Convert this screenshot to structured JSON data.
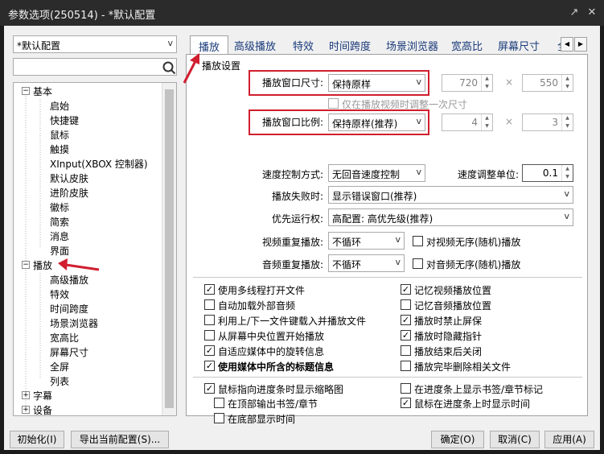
{
  "window": {
    "title": "参数选项(250514) - *默认配置"
  },
  "profile_select": {
    "value": "*默认配置"
  },
  "search": {
    "placeholder": ""
  },
  "tree": {
    "basic": {
      "label": "基本",
      "children": [
        "启始",
        "快捷键",
        "鼠标",
        "触摸",
        "XInput(XBOX 控制器)",
        "默认皮肤",
        "进阶皮肤",
        "徽标",
        "简索",
        "消息",
        "界面"
      ]
    },
    "play": {
      "label": "播放",
      "children": [
        "高级播放",
        "特效",
        "时间跨度",
        "场景浏览器",
        "宽高比",
        "屏幕尺寸",
        "全屏",
        "列表"
      ]
    },
    "subtitle": {
      "label": "字幕"
    },
    "device": {
      "label": "设备"
    }
  },
  "tabs": [
    "播放",
    "高级播放",
    "特效",
    "时间跨度",
    "场景浏览器",
    "宽高比",
    "屏幕尺寸",
    "全"
  ],
  "group_title": "播放设置",
  "settings": {
    "window_size": {
      "label": "播放窗口尺寸:",
      "value": "保持原样",
      "w": "720",
      "h": "550"
    },
    "once_label": "仅在播放视频时调整一次尺寸",
    "window_ratio": {
      "label": "播放窗口比例:",
      "value": "保持原样(推荐)",
      "a": "4",
      "b": "3"
    },
    "speed": {
      "label": "速度控制方式:",
      "value": "无回音速度控制",
      "unit_label": "速度调整单位:",
      "unit": "0.1"
    },
    "fail": {
      "label": "播放失败时:",
      "value": "显示错误窗口(推荐)"
    },
    "priority": {
      "label": "优先运行权:",
      "value": "高配置: 高优先级(推荐)"
    },
    "video_repeat": {
      "label": "视频重复播放:",
      "value": "不循环",
      "shuffle": "对视频无序(随机)播放"
    },
    "audio_repeat": {
      "label": "音频重复播放:",
      "value": "不循环",
      "shuffle": "对音频无序(随机)播放"
    },
    "times": "×"
  },
  "checks_left": [
    {
      "label": "使用多线程打开文件",
      "checked": true,
      "bold": false
    },
    {
      "label": "自动加载外部音频",
      "checked": false,
      "bold": false
    },
    {
      "label": "利用上/下一文件键载入并播放文件",
      "checked": false,
      "bold": false
    },
    {
      "label": "从屏幕中央位置开始播放",
      "checked": false,
      "bold": false
    },
    {
      "label": "自适应媒体中的旋转信息",
      "checked": true,
      "bold": false
    },
    {
      "label": "使用媒体中所含的标题信息",
      "checked": true,
      "bold": true
    }
  ],
  "checks_right": [
    {
      "label": "记忆视频播放位置",
      "checked": true
    },
    {
      "label": "记忆音频播放位置",
      "checked": false
    },
    {
      "label": "播放时禁止屏保",
      "checked": true
    },
    {
      "label": "播放时隐藏指针",
      "checked": true
    },
    {
      "label": "播放结束后关闭",
      "checked": false
    },
    {
      "label": "播放完毕删除相关文件",
      "checked": false
    }
  ],
  "checks_bottom": {
    "thumb": {
      "label": "鼠标指向进度条时显示缩略图",
      "checked": true
    },
    "top_bookmark": {
      "label": "在顶部输出书签/章节",
      "checked": false
    },
    "bottom_time": {
      "label": "在底部显示时间",
      "checked": false
    },
    "bookmark_marker": {
      "label": "在进度条上显示书签/章节标记",
      "checked": false
    },
    "hover_time": {
      "label": "鼠标在进度条上时显示时间",
      "checked": true
    }
  },
  "buttons": {
    "init": "初始化(I)",
    "export": "导出当前配置(S)...",
    "ok": "确定(O)",
    "cancel": "取消(C)",
    "apply": "应用(A)"
  },
  "icons": {
    "search": "search-icon",
    "pin": "pin-icon",
    "close": "close-icon"
  },
  "colors": {
    "annotation": "#d01e2e",
    "tab_text": "#1a3a7a"
  }
}
